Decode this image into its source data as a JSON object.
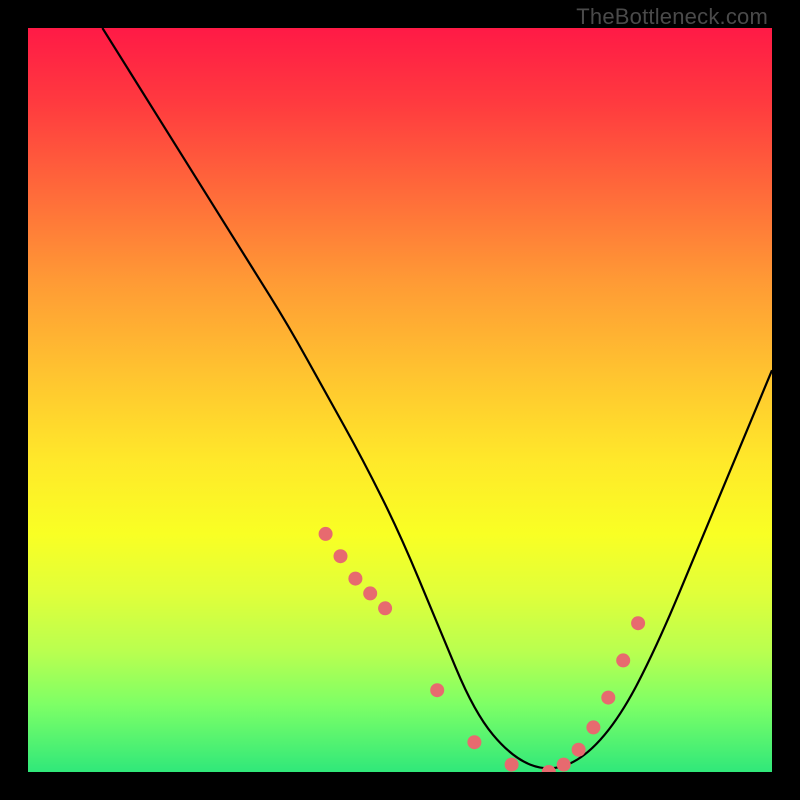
{
  "watermark": "TheBottleneck.com",
  "chart_data": {
    "type": "line",
    "title": "",
    "xlabel": "",
    "ylabel": "",
    "xlim": [
      0,
      100
    ],
    "ylim": [
      0,
      100
    ],
    "series": [
      {
        "name": "bottleneck-curve",
        "x": [
          10,
          15,
          20,
          25,
          30,
          35,
          40,
          45,
          50,
          55,
          60,
          65,
          70,
          75,
          80,
          85,
          90,
          95,
          100
        ],
        "y": [
          100,
          92,
          84,
          76,
          68,
          60,
          51,
          42,
          32,
          20,
          8,
          2,
          0,
          2,
          8,
          18,
          30,
          42,
          54
        ]
      }
    ],
    "markers": {
      "name": "sample-points",
      "color": "#e76a6f",
      "x": [
        40,
        42,
        44,
        46,
        48,
        55,
        60,
        65,
        70,
        72,
        74,
        76,
        78,
        80,
        82
      ],
      "y": [
        32,
        29,
        26,
        24,
        22,
        11,
        4,
        1,
        0,
        1,
        3,
        6,
        10,
        15,
        20
      ]
    }
  }
}
